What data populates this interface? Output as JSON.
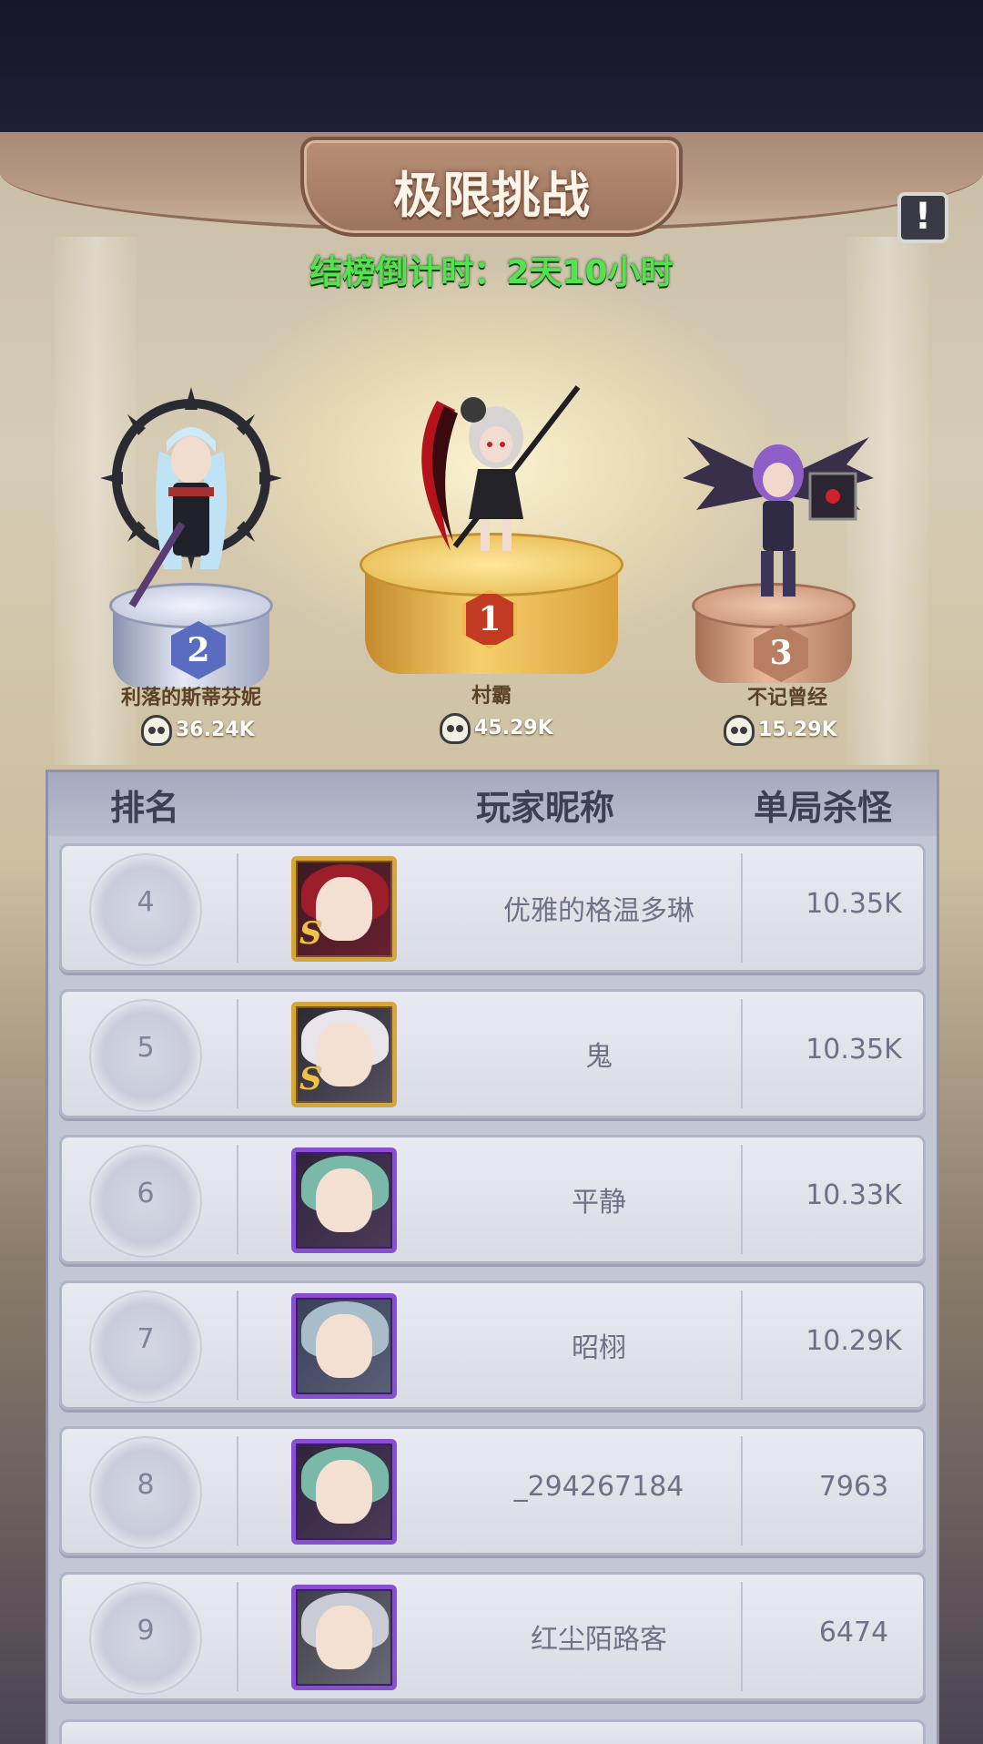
{
  "title": "极限挑战",
  "countdown": "结榜倒计时：2天10小时",
  "info_icon": "exclamation-icon",
  "top3": [
    {
      "rank": "1",
      "name": "村霸",
      "score": "45.29K"
    },
    {
      "rank": "2",
      "name": "利落的斯蒂芬妮",
      "score": "36.24K"
    },
    {
      "rank": "3",
      "name": "不记曾经",
      "score": "15.29K"
    }
  ],
  "table": {
    "headers": {
      "rank": "排名",
      "name": "玩家昵称",
      "kills": "单局杀怪"
    },
    "rows": [
      {
        "rank": "4",
        "name": "优雅的格温多琳",
        "kills": "10.35K",
        "frame": "gold",
        "grade": "S"
      },
      {
        "rank": "5",
        "name": "鬼",
        "kills": "10.35K",
        "frame": "gold",
        "grade": "S"
      },
      {
        "rank": "6",
        "name": "平静",
        "kills": "10.33K",
        "frame": "purple",
        "grade": ""
      },
      {
        "rank": "7",
        "name": "昭栩",
        "kills": "10.29K",
        "frame": "purple",
        "grade": ""
      },
      {
        "rank": "8",
        "name": "_294267184",
        "kills": "7963",
        "frame": "purple",
        "grade": ""
      },
      {
        "rank": "9",
        "name": "红尘陌路客",
        "kills": "6474",
        "frame": "purple",
        "grade": ""
      }
    ]
  },
  "colors": {
    "countdown": "#53e34c",
    "gold_frame": "#d6a53c",
    "purple_frame": "#8a4fd1"
  }
}
